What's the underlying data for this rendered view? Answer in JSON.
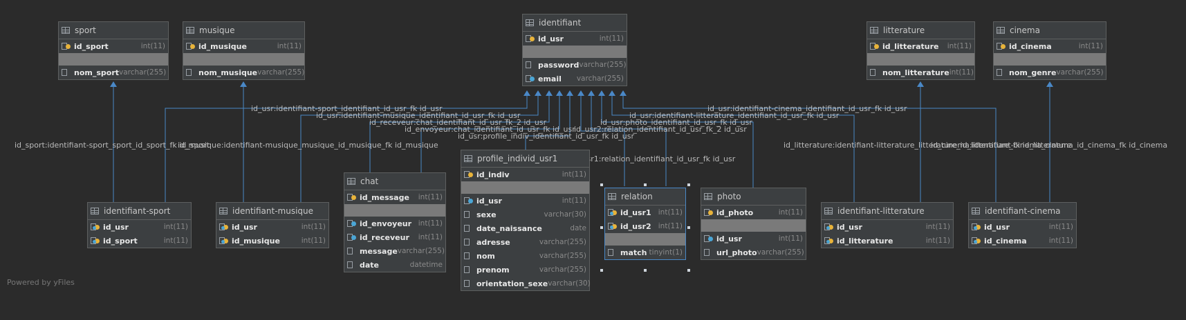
{
  "footer": {
    "powered": "Powered by yFiles"
  },
  "colors": {
    "background": "#2b2b2b",
    "edge": "#4a88c7",
    "table_bg": "#3c3f41",
    "separator": "#7a7a7a",
    "label": "#bbbbbb"
  },
  "tables": [
    {
      "name": "sport",
      "pk": [
        {
          "name": "id_sport",
          "type": "int(11)",
          "icon": "pk"
        }
      ],
      "cols": [
        {
          "name": "nom_sport",
          "type": "varchar(255)",
          "icon": "col"
        }
      ]
    },
    {
      "name": "musique",
      "pk": [
        {
          "name": "id_musique",
          "type": "int(11)",
          "icon": "pk"
        }
      ],
      "cols": [
        {
          "name": "nom_musique",
          "type": "varchar(255)",
          "icon": "col"
        }
      ]
    },
    {
      "name": "identifiant",
      "pk": [
        {
          "name": "id_usr",
          "type": "int(11)",
          "icon": "pk"
        }
      ],
      "cols": [
        {
          "name": "password",
          "type": "varchar(255)",
          "icon": "col"
        },
        {
          "name": "email",
          "type": "varchar(255)",
          "icon": "fk"
        }
      ]
    },
    {
      "name": "litterature",
      "pk": [
        {
          "name": "id_litterature",
          "type": "int(11)",
          "icon": "pk"
        }
      ],
      "cols": [
        {
          "name": "nom_litterature",
          "type": "int(11)",
          "icon": "col"
        }
      ]
    },
    {
      "name": "cinema",
      "pk": [
        {
          "name": "id_cinema",
          "type": "int(11)",
          "icon": "pk"
        }
      ],
      "cols": [
        {
          "name": "nom_genre",
          "type": "varchar(255)",
          "icon": "col"
        }
      ]
    },
    {
      "name": "identifiant-sport",
      "pk": [
        {
          "name": "id_usr",
          "type": "int(11)",
          "icon": "pkfk"
        },
        {
          "name": "id_sport",
          "type": "int(11)",
          "icon": "pkfk"
        }
      ],
      "cols": []
    },
    {
      "name": "identifiant-musique",
      "pk": [
        {
          "name": "id_usr",
          "type": "int(11)",
          "icon": "pkfk"
        },
        {
          "name": "id_musique",
          "type": "int(11)",
          "icon": "pkfk"
        }
      ],
      "cols": []
    },
    {
      "name": "chat",
      "pk": [
        {
          "name": "id_message",
          "type": "int(11)",
          "icon": "pk"
        }
      ],
      "cols": [
        {
          "name": "id_envoyeur",
          "type": "int(11)",
          "icon": "fk"
        },
        {
          "name": "id_receveur",
          "type": "int(11)",
          "icon": "fk"
        },
        {
          "name": "message",
          "type": "varchar(255)",
          "icon": "col"
        },
        {
          "name": "date",
          "type": "datetime",
          "icon": "col"
        }
      ]
    },
    {
      "name": "profile_individ_usr1",
      "pk": [
        {
          "name": "id_indiv",
          "type": "int(11)",
          "icon": "pk"
        }
      ],
      "cols": [
        {
          "name": "id_usr",
          "type": "int(11)",
          "icon": "fk"
        },
        {
          "name": "sexe",
          "type": "varchar(30)",
          "icon": "col"
        },
        {
          "name": "date_naissance",
          "type": "date",
          "icon": "col"
        },
        {
          "name": "adresse",
          "type": "varchar(255)",
          "icon": "col"
        },
        {
          "name": "nom",
          "type": "varchar(255)",
          "icon": "col"
        },
        {
          "name": "prenom",
          "type": "varchar(255)",
          "icon": "col"
        },
        {
          "name": "orientation_sexe",
          "type": "varchar(30)",
          "icon": "col"
        }
      ]
    },
    {
      "name": "relation",
      "pk": [
        {
          "name": "id_usr1",
          "type": "int(11)",
          "icon": "pkfk"
        },
        {
          "name": "id_usr2",
          "type": "int(11)",
          "icon": "pkfk"
        }
      ],
      "cols": [
        {
          "name": "match",
          "type": "tinyint(1)",
          "icon": "col"
        }
      ]
    },
    {
      "name": "photo",
      "pk": [
        {
          "name": "id_photo",
          "type": "int(11)",
          "icon": "pk"
        }
      ],
      "cols": [
        {
          "name": "id_usr",
          "type": "int(11)",
          "icon": "fk"
        },
        {
          "name": "url_photo",
          "type": "varchar(255)",
          "icon": "col"
        }
      ]
    },
    {
      "name": "identifiant-litterature",
      "pk": [
        {
          "name": "id_usr",
          "type": "int(11)",
          "icon": "pkfk"
        },
        {
          "name": "id_litterature",
          "type": "int(11)",
          "icon": "pkfk"
        }
      ],
      "cols": []
    },
    {
      "name": "identifiant-cinema",
      "pk": [
        {
          "name": "id_usr",
          "type": "int(11)",
          "icon": "pkfk"
        },
        {
          "name": "id_cinema",
          "type": "int(11)",
          "icon": "pkfk"
        }
      ],
      "cols": []
    }
  ],
  "edge_labels": [
    "id_usr:identifiant-sport_identifiant_id_usr_fk id_usr",
    "id_usr:identifiant-musique_identifiant_id_usr_fk id_usr",
    "id_receveur:chat_identifiant_id_usr_fk_2 id_usr",
    "id_envoyeur:chat_identifiant_id_usr_fk id_usr",
    "id_usr:profile_indiv_identifiant_id_usr_fk id_usr",
    "id_usr2:relation_identifiant_id_usr_fk_2 id_usr",
    "id_usr:photo_identifiant_id_usr_fk id_usr",
    "id_usr:identifiant-litterature_identifiant_id_usr_fk id_usr",
    "id_usr:identifiant-cinema_identifiant_id_usr_fk id_usr",
    "id_usr1:relation_identifiant_id_usr_fk id_usr",
    "id_sport:identifiant-sport_sport_id_sport_fk id_sport",
    "id_musique:identifiant-musique_musique_id_musique_fk id_musique",
    "id_litterature:identifiant-litterature_litterature_id_litterature_fk id_litterature",
    "id_cinema:identifiant-cinema_cinema_id_cinema_fk id_cinema"
  ]
}
